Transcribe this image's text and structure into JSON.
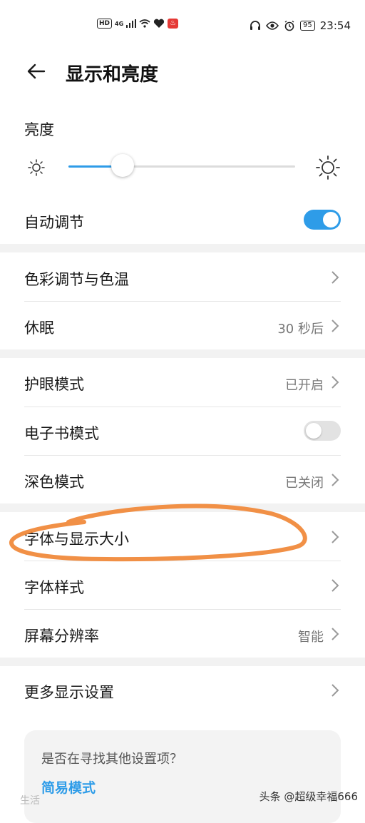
{
  "status_bar": {
    "hd": "HD",
    "network": "4G",
    "battery": "95",
    "time": "23:54"
  },
  "header": {
    "title": "显示和亮度"
  },
  "brightness": {
    "label": "亮度",
    "level_percent": 24
  },
  "rows": {
    "auto_adjust": {
      "label": "自动调节",
      "on": true
    },
    "color_temp": {
      "label": "色彩调节与色温"
    },
    "sleep": {
      "label": "休眠",
      "value": "30 秒后"
    },
    "eye_comfort": {
      "label": "护眼模式",
      "value": "已开启"
    },
    "ebook": {
      "label": "电子书模式",
      "on": false
    },
    "dark_mode": {
      "label": "深色模式",
      "value": "已关闭"
    },
    "font_display_size": {
      "label": "字体与显示大小"
    },
    "font_style": {
      "label": "字体样式"
    },
    "resolution": {
      "label": "屏幕分辨率",
      "value": "智能"
    },
    "more_display": {
      "label": "更多显示设置"
    }
  },
  "suggestion": {
    "question": "是否在寻找其他设置项？",
    "link": "简易模式"
  },
  "watermark": {
    "text": "头条 @超级幸福666",
    "left_text": "生活"
  },
  "colors": {
    "accent": "#2e9ce8",
    "highlight": "#f08a3c"
  }
}
